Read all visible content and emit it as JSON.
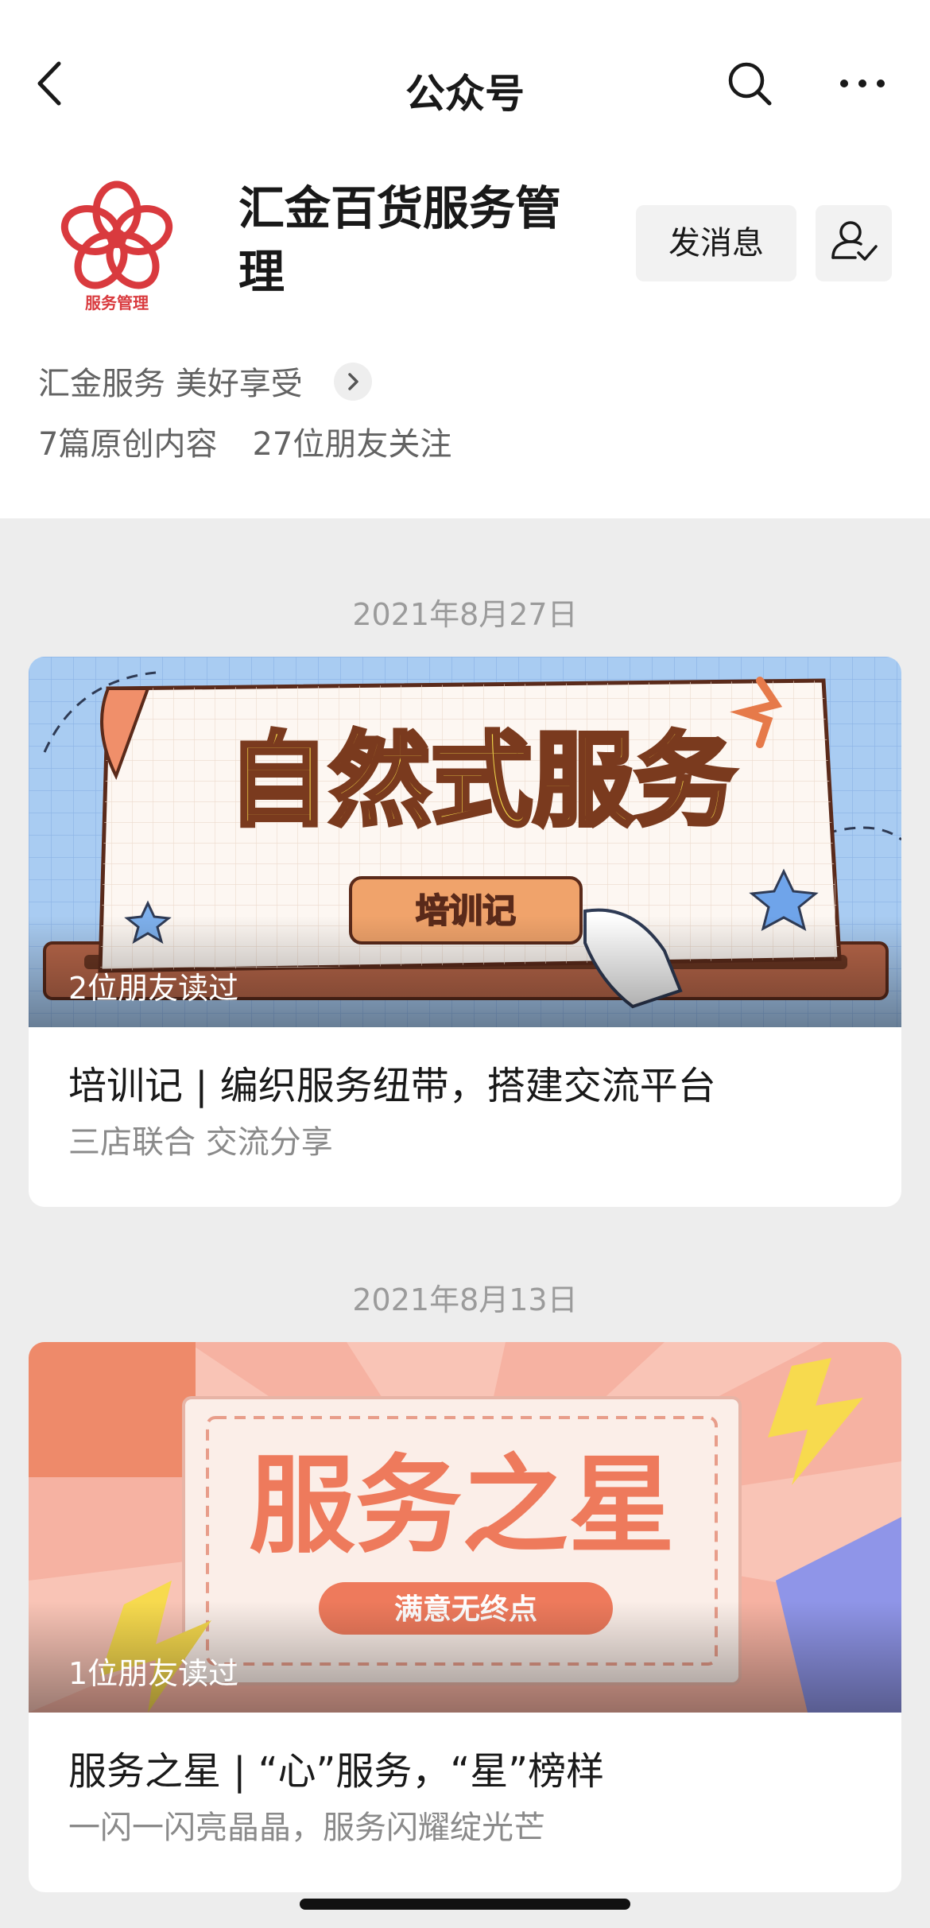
{
  "navbar": {
    "title": "公众号",
    "icons": [
      "back-chevron-icon",
      "search-icon",
      "more-dots-icon"
    ]
  },
  "account": {
    "name": "汇金百货服务管理",
    "logo_text": "服务管理",
    "message_button": "发消息",
    "follow_icon": "user-check-icon",
    "slogan": "汇金服务 美好享受",
    "original_count": "7篇原创内容",
    "followers": "27位朋友关注",
    "brand_color": "#d93a3e"
  },
  "articles": [
    {
      "date": "2021年8月27日",
      "cover_heading": "自然式服务",
      "cover_tag": "培训记",
      "readers": "2位朋友读过",
      "title": "培训记 | 编织服务纽带，搭建交流平台",
      "subtitle": "三店联合 交流分享"
    },
    {
      "date": "2021年8月13日",
      "cover_heading": "服务之星",
      "cover_tag": "满意无终点",
      "readers": "1位朋友读过",
      "title": "服务之星 | “心”服务，“星”榜样",
      "subtitle": "一闪一闪亮晶晶，服务闪耀绽光芒"
    }
  ]
}
